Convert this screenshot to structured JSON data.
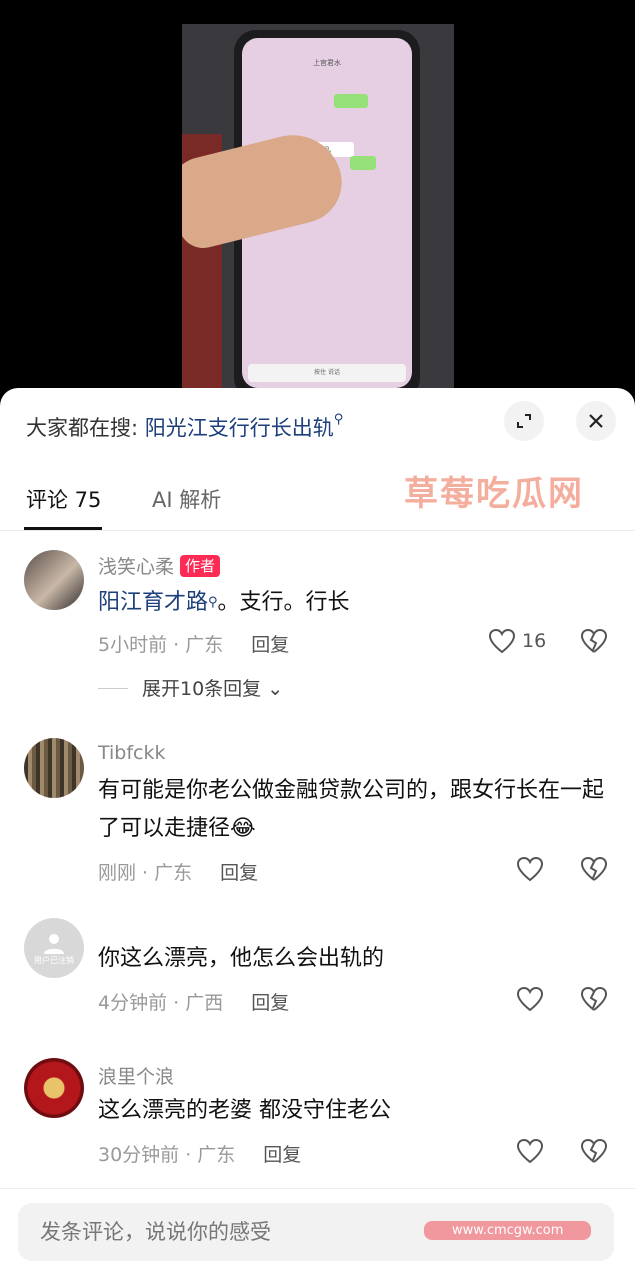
{
  "video": {
    "chat_title": "上官君水",
    "msg_text": "你老婆出去刷，睡电视。",
    "input_hint": "按住 说话"
  },
  "search": {
    "prefix": "大家都在搜: ",
    "term": "阳光江支行行长出轨"
  },
  "tabs": [
    {
      "label": "评论 75"
    },
    {
      "label": "AI 解析"
    }
  ],
  "comments": [
    {
      "user": "浅笑心柔",
      "badge": "作者",
      "mention": "阳江育才路",
      "text": "。支行。行长",
      "time": "5小时前 · 广东",
      "reply": "回复",
      "likes": "16",
      "expand": "展开10条回复"
    },
    {
      "user": "Tibfckk",
      "text": "有可能是你老公做金融贷款公司的，跟女行长在一起了可以走捷径",
      "emoji": "😂",
      "time": "刚刚 · 广东",
      "reply": "回复"
    },
    {
      "user": "",
      "avatar_text": "用户已注销",
      "text": "你这么漂亮，他怎么会出轨的",
      "time": "4分钟前 · 广西",
      "reply": "回复"
    },
    {
      "user": "浪里个浪",
      "text": "这么漂亮的老婆   都没守住老公",
      "time": "30分钟前 · 广东",
      "reply": "回复"
    }
  ],
  "composer": {
    "placeholder": "发条评论，说说你的感受"
  },
  "watermark": {
    "text": "草莓吃瓜网",
    "url": "www.cmcgw.com"
  },
  "colors": {
    "accent_link": "#1d3f7c",
    "badge_red": "#fe2c55"
  }
}
